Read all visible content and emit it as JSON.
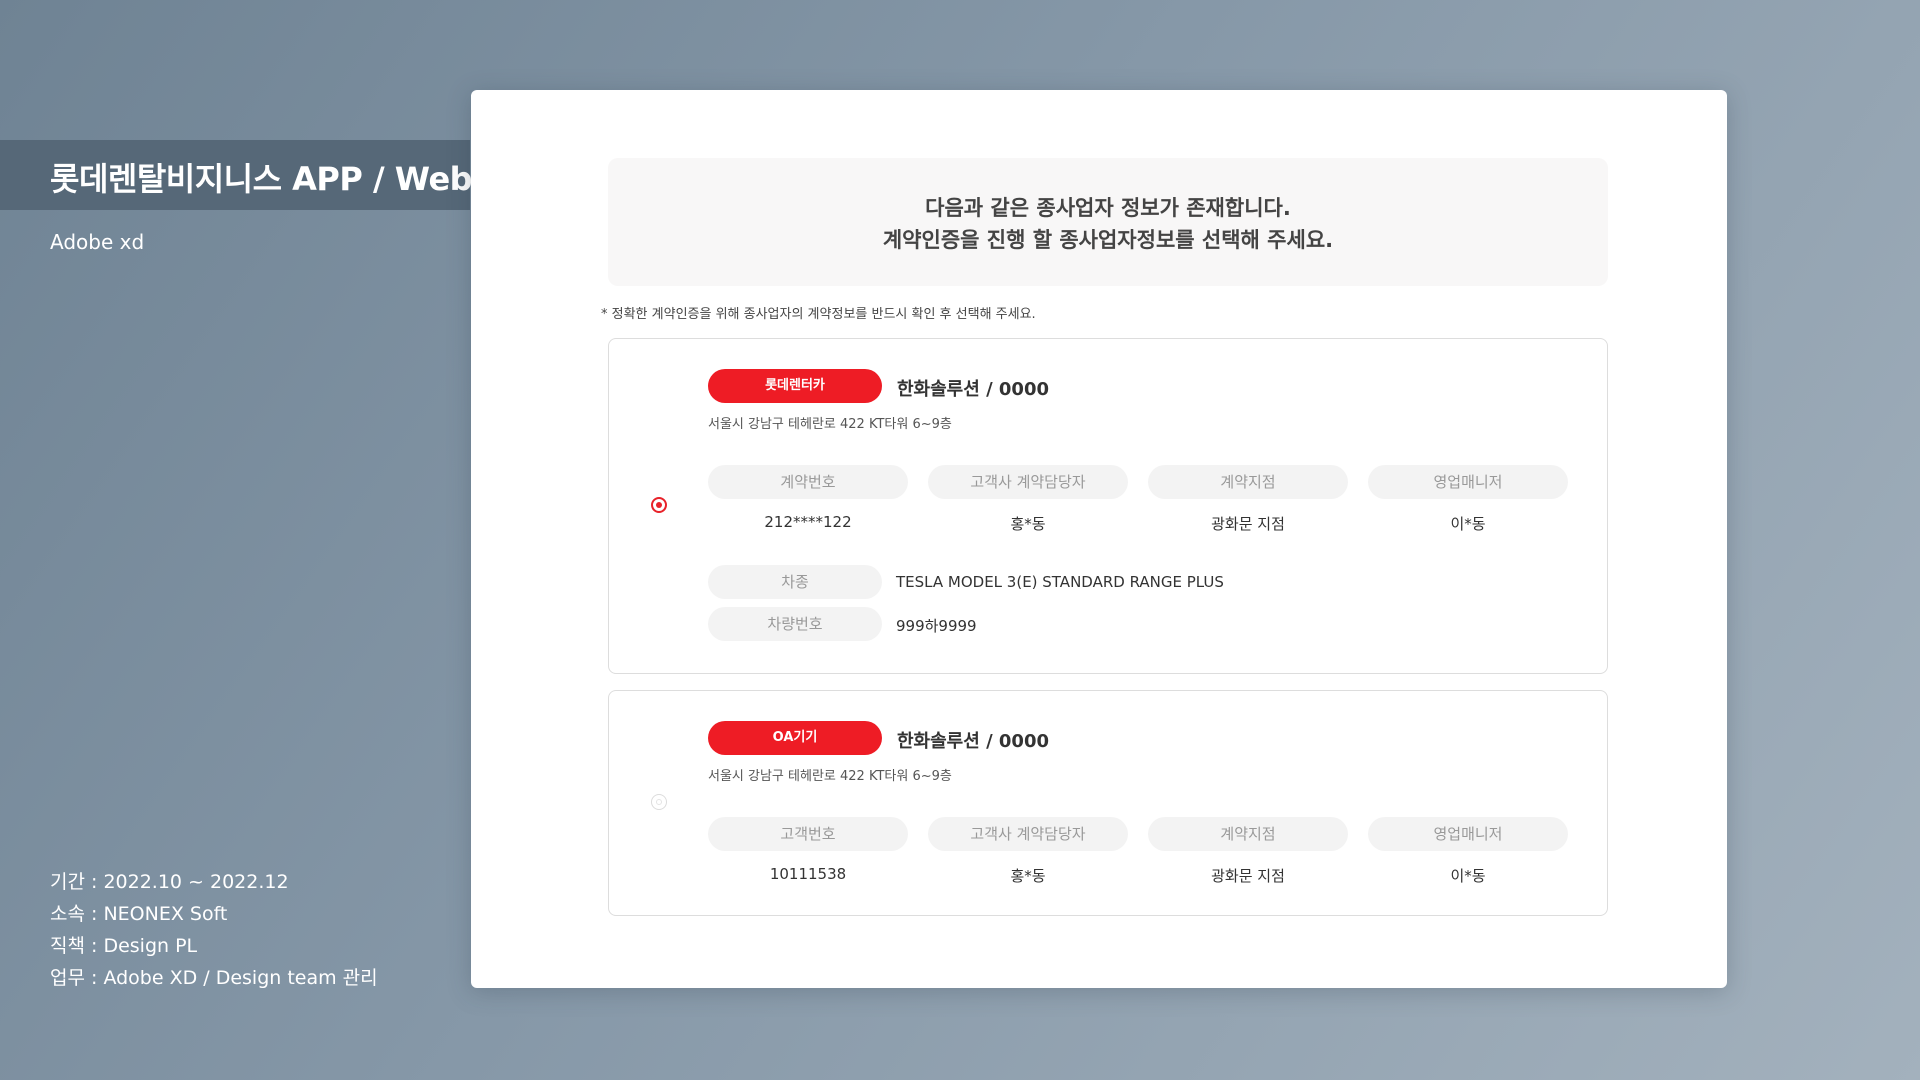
{
  "portfolio": {
    "title": "롯데렌탈비지니스 APP / Web",
    "tool": "Adobe xd",
    "info": [
      "기간 : 2022.10 ~ 2022.12",
      "소속 : NEONEX Soft",
      "직책 : Design PL",
      "업무 : Adobe XD / Design team 관리"
    ]
  },
  "notice": {
    "line1": "다음과 같은 종사업자 정보가 존재합니다.",
    "line2": "계약인증을 진행 할 종사업자정보를 선택해 주세요."
  },
  "hint": "* 정확한 계약인증을 위해 종사업자의 계약정보를 반드시 확인 후 선택해 주세요.",
  "cards": [
    {
      "selected": true,
      "badge": "롯데렌터카",
      "company": "한화솔루션 / 0000",
      "address": "서울시 강남구 테헤란로 422 KT타워 6~9층",
      "fields": [
        {
          "label": "계약번호",
          "value": "212****122"
        },
        {
          "label": "고객사 계약담당자",
          "value": "홍*동"
        },
        {
          "label": "계약지점",
          "value": "광화문 지점"
        },
        {
          "label": "영업매니저",
          "value": "이*동"
        }
      ],
      "specs": [
        {
          "label": "차종",
          "value": "TESLA MODEL 3(E) STANDARD RANGE PLUS"
        },
        {
          "label": "차량번호",
          "value": "999하9999"
        }
      ]
    },
    {
      "selected": false,
      "badge": "OA기기",
      "company": "한화솔루션 / 0000",
      "address": "서울시 강남구 테헤란로 422 KT타워 6~9층",
      "fields": [
        {
          "label": "고객번호",
          "value": "10111538"
        },
        {
          "label": "고객사 계약담당자",
          "value": "홍*동"
        },
        {
          "label": "계약지점",
          "value": "광화문 지점"
        },
        {
          "label": "영업매니저",
          "value": "이*동"
        }
      ]
    }
  ],
  "colors": {
    "accent": "#ee1c25",
    "radio_selected": "#e8222a",
    "label_bg": "#f3f3f3",
    "notice_bg": "#f8f7f7"
  }
}
